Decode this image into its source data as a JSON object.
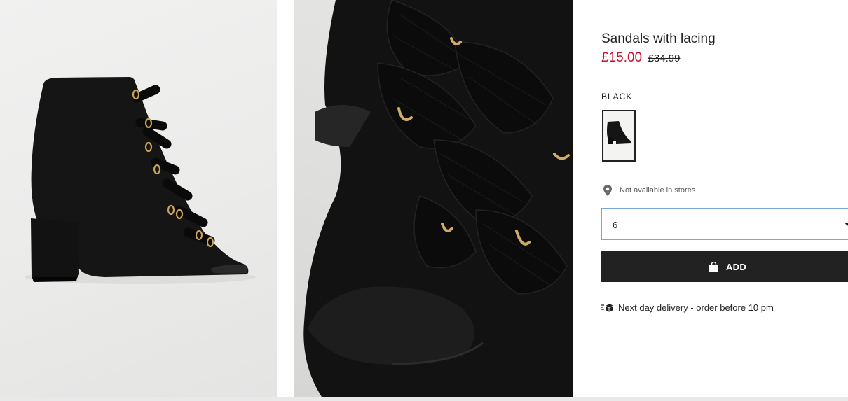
{
  "gallery": {
    "images": [
      {
        "name": "side-view",
        "alt": ""
      },
      {
        "name": "close-up",
        "alt": ""
      }
    ]
  },
  "product": {
    "title": "Sandals with lacing",
    "price_sale": "£15.00",
    "price_original": "£34.99",
    "colour": "BLACK",
    "swatch_icon": "boot-thumbnail",
    "store_icon": "location-pin-icon",
    "store_availability": "Not available in stores",
    "size_select": {
      "value": "6",
      "icon": "chevron-down-icon"
    },
    "add_button": {
      "label": "ADD",
      "icon": "shopping-bag-icon"
    },
    "delivery": {
      "icon": "delivery-truck-icon",
      "text": "Next day delivery - order before 10 pm"
    }
  },
  "colors": {
    "sale_price": "#c8102e",
    "button_bg": "#222222",
    "select_border": "#7aa7e0"
  }
}
